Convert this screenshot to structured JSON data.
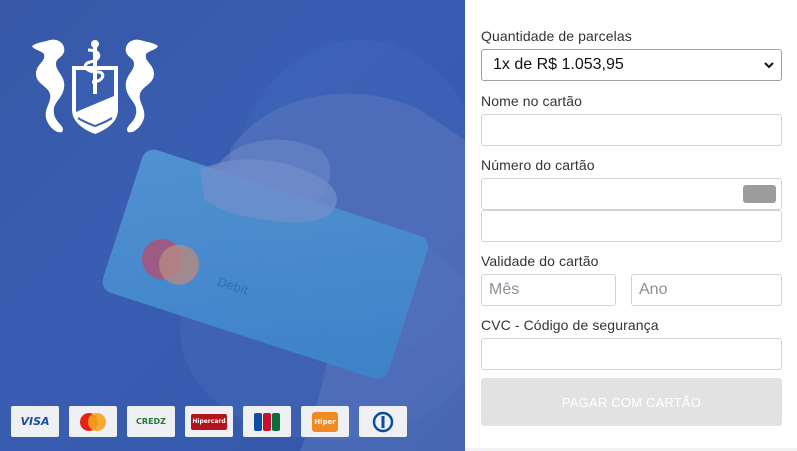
{
  "form": {
    "installments_label": "Quantidade de parcelas",
    "installments_value": "1x de R$ 1.053,95",
    "name_label": "Nome no cartão",
    "name_value": "",
    "number_label": "Número do cartão",
    "number_value": "",
    "expiry_label": "Validade do cartão",
    "month_placeholder": "Mês",
    "year_placeholder": "Ano",
    "cvc_label": "CVC - Código de segurança",
    "cvc_value": "",
    "pay_label": "PAGAR COM CARTÃO"
  },
  "brands": [
    {
      "name": "visa-logo",
      "label": "VISA",
      "color": "#1a4fa0"
    },
    {
      "name": "mastercard-logo",
      "label": "MasterCard",
      "color": "#e2231a"
    },
    {
      "name": "credz-logo",
      "label": "CREDZ",
      "color": "#1f7a3a"
    },
    {
      "name": "hipercard-logo",
      "label": "Hipercard",
      "color": "#b3131b"
    },
    {
      "name": "jcb-logo",
      "label": "JCB",
      "color": "#0b6d3b"
    },
    {
      "name": "hiper-logo",
      "label": "Hiper",
      "color": "#f08a24"
    },
    {
      "name": "diners-logo",
      "label": "",
      "color": "#0a4aa3"
    }
  ],
  "colors": {
    "panel_blue": "#3a5eb0",
    "button_disabled": "#e2e2e2"
  }
}
